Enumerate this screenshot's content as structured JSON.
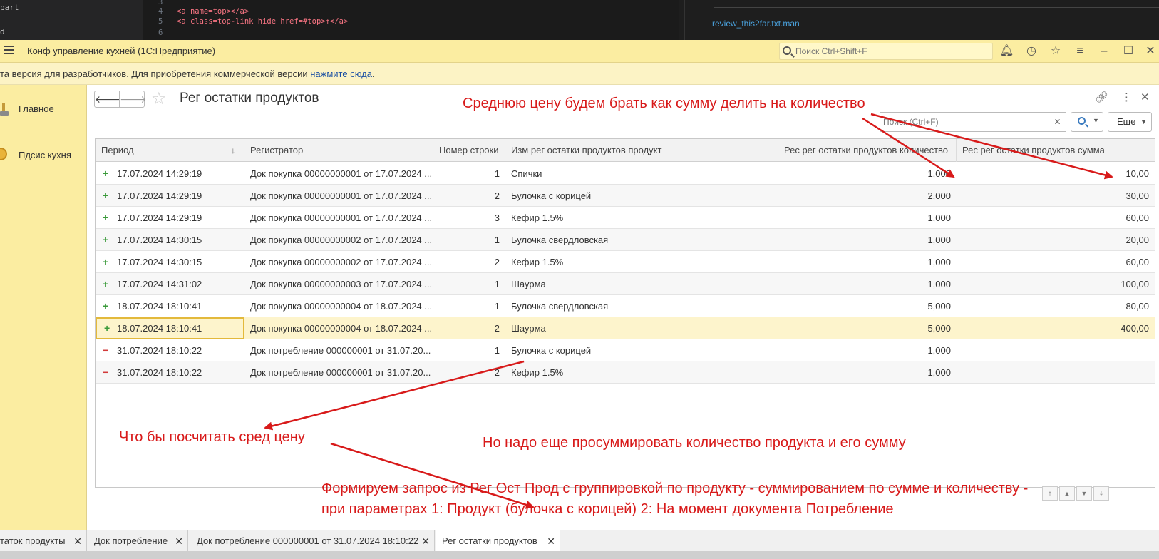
{
  "editor": {
    "left_lines": [
      "part",
      "d"
    ],
    "code_lines": [
      {
        "num": "3",
        "text": ""
      },
      {
        "num": "4",
        "text": "<a name=top></a>"
      },
      {
        "num": "5",
        "text": "<a class=top-link hide href=#top>↑</a>"
      },
      {
        "num": "6",
        "text": ""
      }
    ],
    "right_file": "review_this2far.txt.man"
  },
  "titlebar": {
    "title": "Конф управление кухней  (1С:Предприятие)",
    "search_placeholder": "Поиск Ctrl+Shift+F",
    "icons": [
      "bell-icon",
      "history-icon",
      "star-icon",
      "settings-icon",
      "minimize-icon",
      "maximize-icon",
      "close-icon"
    ]
  },
  "infobar": {
    "text": "та версия для разработчиков. Для приобретения коммерческой версии ",
    "link": "нажмите сюда",
    "tail": "."
  },
  "sections": [
    {
      "label": "Главное",
      "icon": "main-section-icon"
    },
    {
      "label": "Пдсис кухня",
      "icon": "kitchen-section-icon"
    }
  ],
  "form": {
    "title": "Рег остатки продуктов",
    "search_placeholder": "Поиск (Ctrl+F)",
    "more_label": "Еще",
    "columns": [
      "Период",
      "Регистратор",
      "Номер строки",
      "Изм рег остатки продуктов продукт",
      "Рес рег остатки продуктов количество",
      "Рес рег остатки продуктов сумма"
    ],
    "rows": [
      {
        "movement": "+",
        "period": "17.07.2024 14:29:19",
        "registrar": "Док покупка 00000000001 от 17.07.2024 ...",
        "line": "1",
        "product": "Спички",
        "qty": "1,000",
        "sum": "10,00"
      },
      {
        "movement": "+",
        "period": "17.07.2024 14:29:19",
        "registrar": "Док покупка 00000000001 от 17.07.2024 ...",
        "line": "2",
        "product": "Булочка с корицей",
        "qty": "2,000",
        "sum": "30,00"
      },
      {
        "movement": "+",
        "period": "17.07.2024 14:29:19",
        "registrar": "Док покупка 00000000001 от 17.07.2024 ...",
        "line": "3",
        "product": "Кефир 1.5%",
        "qty": "1,000",
        "sum": "60,00"
      },
      {
        "movement": "+",
        "period": "17.07.2024 14:30:15",
        "registrar": "Док покупка 00000000002 от 17.07.2024 ...",
        "line": "1",
        "product": "Булочка свердловская",
        "qty": "1,000",
        "sum": "20,00"
      },
      {
        "movement": "+",
        "period": "17.07.2024 14:30:15",
        "registrar": "Док покупка 00000000002 от 17.07.2024 ...",
        "line": "2",
        "product": "Кефир 1.5%",
        "qty": "1,000",
        "sum": "60,00"
      },
      {
        "movement": "+",
        "period": "17.07.2024 14:31:02",
        "registrar": "Док покупка 00000000003 от 17.07.2024 ...",
        "line": "1",
        "product": "Шаурма",
        "qty": "1,000",
        "sum": "100,00"
      },
      {
        "movement": "+",
        "period": "18.07.2024 18:10:41",
        "registrar": "Док покупка 00000000004 от 18.07.2024 ...",
        "line": "1",
        "product": "Булочка свердловская",
        "qty": "5,000",
        "sum": "80,00"
      },
      {
        "movement": "+",
        "period": "18.07.2024 18:10:41",
        "registrar": "Док покупка 00000000004 от 18.07.2024 ...",
        "line": "2",
        "product": "Шаурма",
        "qty": "5,000",
        "sum": "400,00"
      },
      {
        "movement": "−",
        "period": "31.07.2024 18:10:22",
        "registrar": "Док потребление 000000001 от 31.07.20...",
        "line": "1",
        "product": "Булочка с корицей",
        "qty": "1,000",
        "sum": ""
      },
      {
        "movement": "−",
        "period": "31.07.2024 18:10:22",
        "registrar": "Док потребление 000000001 от 31.07.20...",
        "line": "2",
        "product": "Кефир 1.5%",
        "qty": "1,000",
        "sum": ""
      }
    ]
  },
  "annotations": {
    "top": "Среднюю цену будем брать как сумму делить на количество",
    "left": "Что бы посчитать сред цену",
    "mid": "Но надо еще просуммировать количество продукта и его сумму",
    "bottom1": "Формируем запрос из Рег Ост Прод с группировкой по продукту - суммированием по сумме и количеству -",
    "bottom2": "при параметрах 1: Продукт (булочка с корицей) 2: На момент документа Потребление"
  },
  "tabs": [
    {
      "label": "таток продукты",
      "active": false
    },
    {
      "label": "Док потребление",
      "active": false
    },
    {
      "label": "Док потребление 000000001 от 31.07.2024 18:10:22",
      "active": false
    },
    {
      "label": "Рег остатки продуктов",
      "active": true
    }
  ],
  "colors": {
    "titlebar": "#fbeda1",
    "selected_row": "#fdf4cc",
    "annotation": "#d81a1a",
    "plus": "#3a9a3a",
    "minus": "#d23a3a"
  }
}
